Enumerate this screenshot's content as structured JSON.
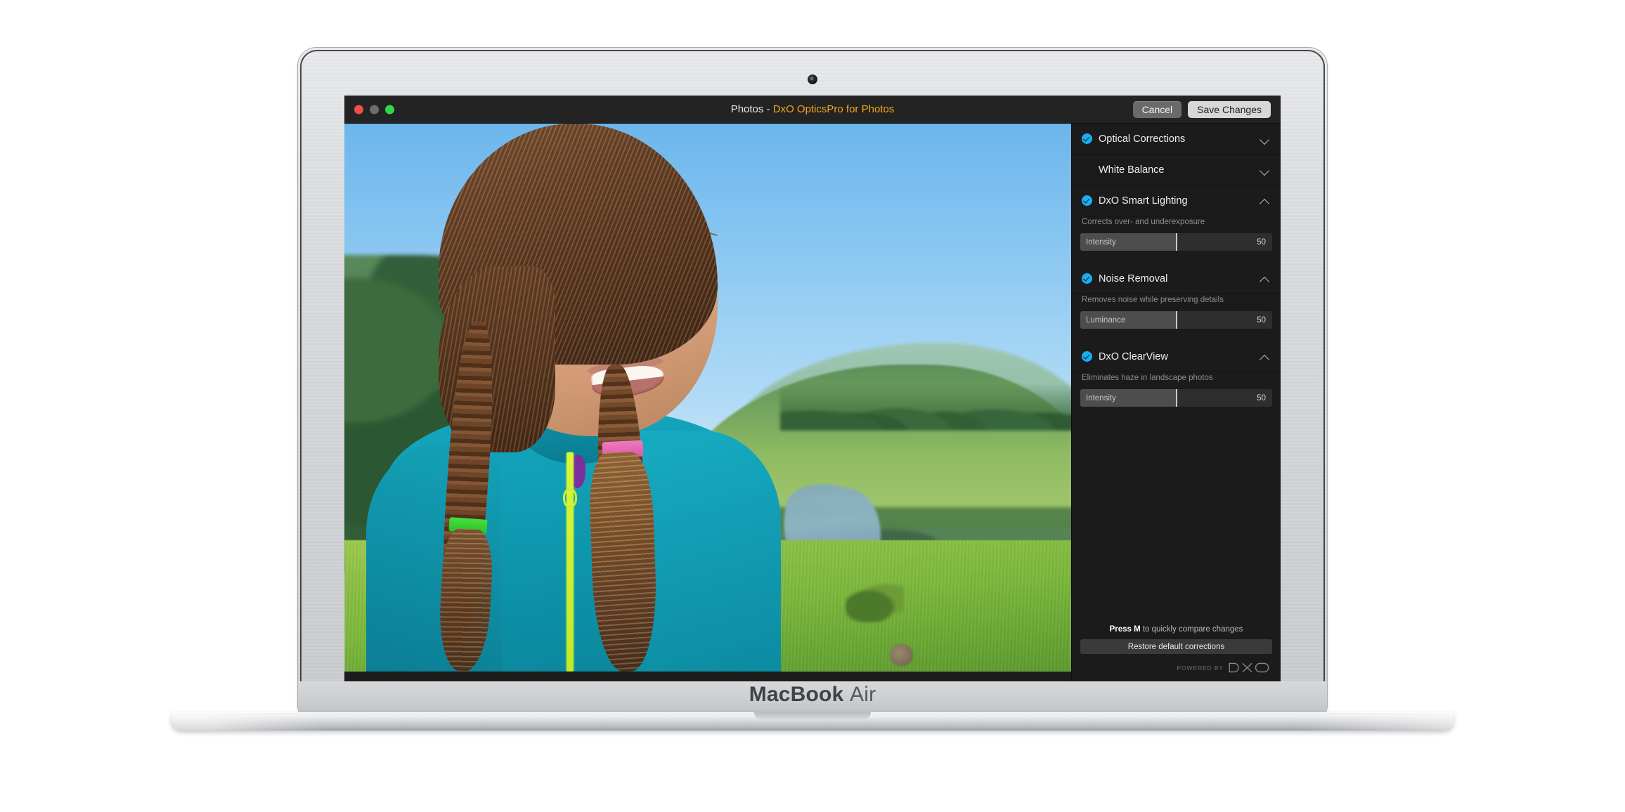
{
  "device": {
    "brand_bold": "MacBook",
    "brand_light": "Air"
  },
  "window": {
    "title_prefix": "Photos",
    "title_separator": " - ",
    "title_app": "DxO OpticsPro for Photos",
    "traffic_lights": [
      "close-red",
      "minimize-gray",
      "zoom-green"
    ],
    "cancel_label": "Cancel",
    "save_label": "Save Changes",
    "accent_title_color": "#f3a71a",
    "accent_check_color": "#19aef0"
  },
  "panel": {
    "sections": [
      {
        "name": "optical-corrections",
        "title": "Optical Corrections",
        "enabled": true,
        "expanded": false,
        "description": null,
        "slider": null
      },
      {
        "name": "white-balance",
        "title": "White Balance",
        "enabled": false,
        "expanded": false,
        "description": null,
        "slider": null
      },
      {
        "name": "dxo-smart-lighting",
        "title": "DxO Smart Lighting",
        "enabled": true,
        "expanded": true,
        "description": "Corrects over- and underexposure",
        "slider": {
          "label": "Intensity",
          "value": "50",
          "percent": 50
        }
      },
      {
        "name": "noise-removal",
        "title": "Noise Removal",
        "enabled": true,
        "expanded": true,
        "description": "Removes noise while preserving details",
        "slider": {
          "label": "Luminance",
          "value": "50",
          "percent": 50
        }
      },
      {
        "name": "dxo-clearview",
        "title": "DxO ClearView",
        "enabled": true,
        "expanded": true,
        "description": "Eliminates haze in landscape photos",
        "slider": {
          "label": "Intensity",
          "value": "50",
          "percent": 50
        }
      }
    ],
    "footer": {
      "hint_strong": "Press M",
      "hint_rest": " to quickly compare changes",
      "restore_label": "Restore default corrections",
      "powered_by": "POWERED BY",
      "logo_name": "DxO"
    }
  },
  "photo": {
    "subject": "girl-with-braids",
    "scene": "green-hills-river-landscape",
    "jacket_color": "#0f9cb3",
    "zipper_color": "#cdee2e",
    "hair_tie_left_color": "#38d132",
    "hair_tie_right_color": "#e86bb4",
    "sky_color": "#7cbfee",
    "grass_color": "#86bf40"
  }
}
